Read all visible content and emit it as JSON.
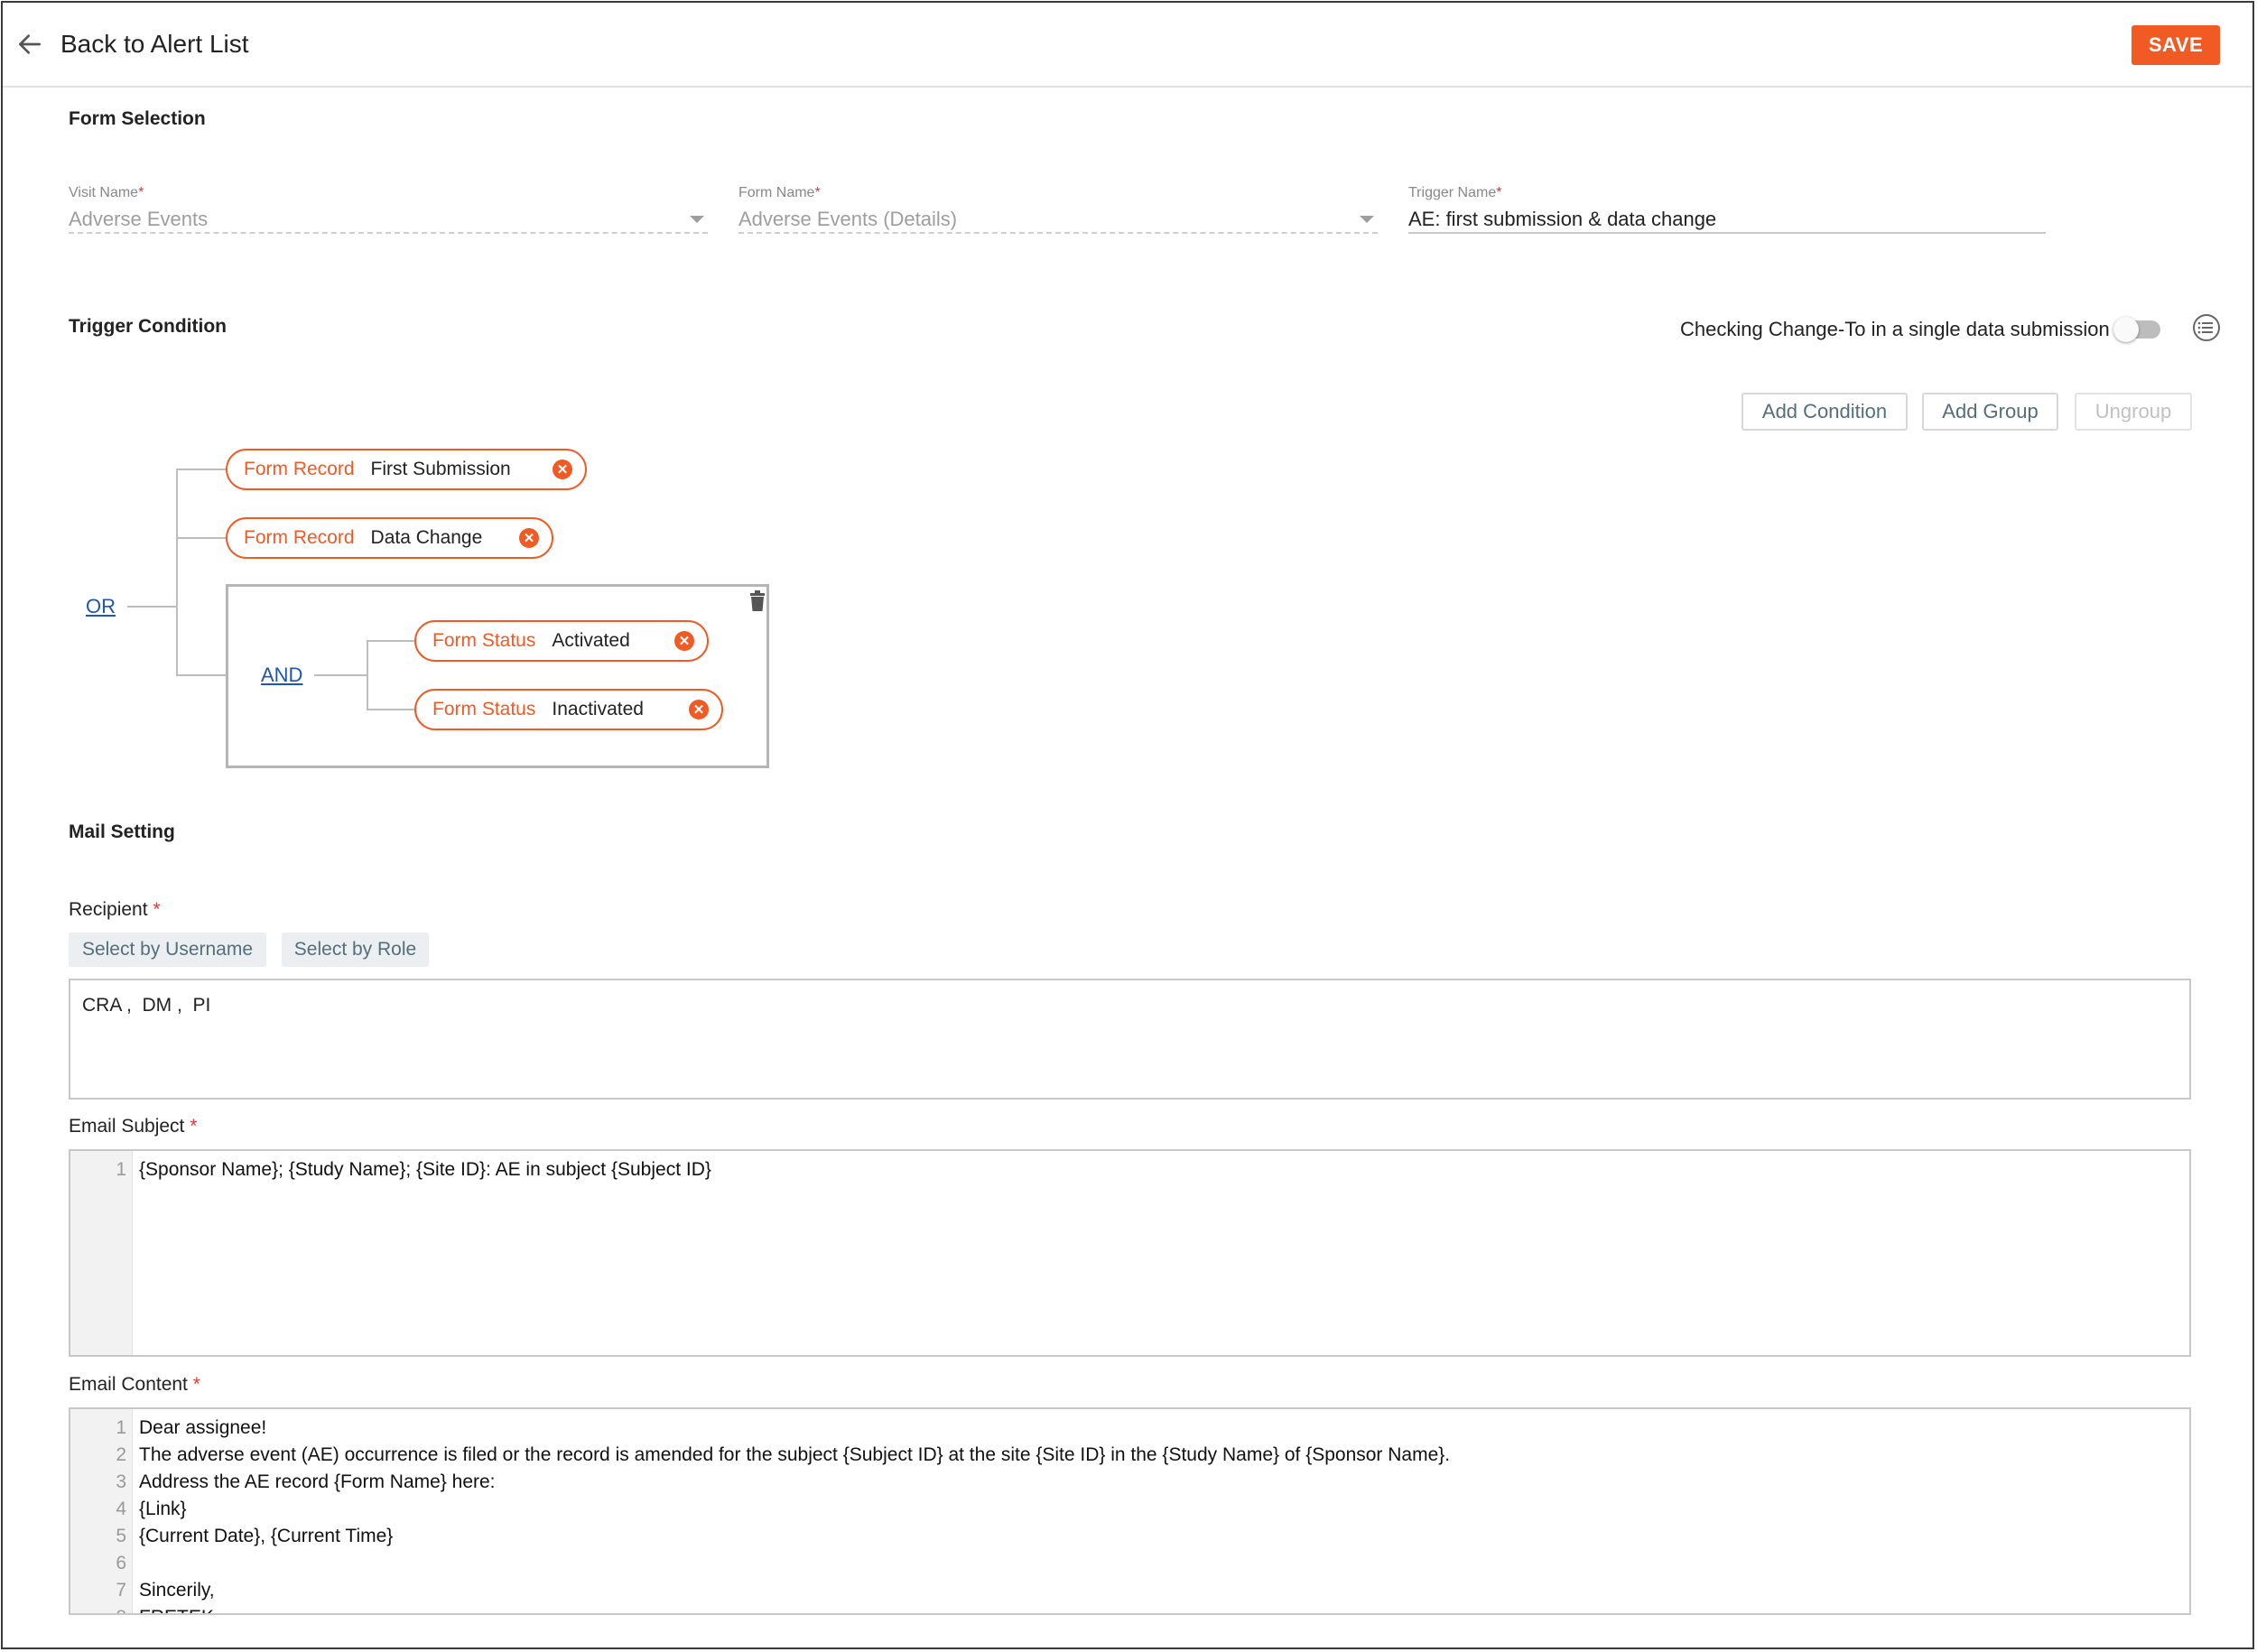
{
  "header": {
    "back_label": "Back to Alert List",
    "save_label": "SAVE"
  },
  "form_selection": {
    "title": "Form Selection",
    "visit": {
      "label": "Visit Name",
      "required": "*",
      "value": "Adverse Events"
    },
    "form": {
      "label": "Form Name",
      "required": "*",
      "value": "Adverse Events (Details)"
    },
    "trigger": {
      "label": "Trigger Name",
      "required": "*",
      "value": "AE: first submission & data change"
    }
  },
  "trigger_condition": {
    "title": "Trigger Condition",
    "toggle_label": "Checking Change-To in a single data submission",
    "toggle_on": false,
    "buttons": {
      "add_condition": "Add Condition",
      "add_group": "Add Group",
      "ungroup": "Ungroup"
    },
    "root_operator": "OR",
    "conditions": [
      {
        "type": "Form Record",
        "value": "First Submission"
      },
      {
        "type": "Form Record",
        "value": "Data Change"
      }
    ],
    "group": {
      "operator": "AND",
      "conditions": [
        {
          "type": "Form Status",
          "value": "Activated"
        },
        {
          "type": "Form Status",
          "value": "Inactivated"
        }
      ]
    }
  },
  "mail_setting": {
    "title": "Mail Setting",
    "recipient": {
      "label": "Recipient",
      "required": "*",
      "select_by_username": "Select by Username",
      "select_by_role": "Select by Role",
      "value": "CRA ,  DM ,  PI"
    },
    "subject": {
      "label": "Email Subject",
      "required": "*",
      "lines": [
        "{Sponsor Name}; {Study Name}; {Site ID}: AE in subject {Subject ID}"
      ]
    },
    "content": {
      "label": "Email Content",
      "required": "*",
      "lines": [
        "Dear assignee!",
        "The adverse event (AE) occurrence is filed or the record is amended for the subject {Subject ID} at the site {Site ID} in the {Study Name} of {Sponsor Name}.",
        "Address the AE record {Form Name} here:",
        "{Link}",
        "{Current Date}, {Current Time}",
        "",
        "Sincerily,",
        "FRETEK"
      ]
    }
  },
  "colors": {
    "accent": "#f25a24",
    "link": "#1e56b3",
    "required": "#e53935"
  },
  "icons": {
    "back": "arrow-left-icon",
    "remove": "close-circle-icon",
    "delete_group": "trash-icon",
    "list": "list-settings-icon"
  }
}
